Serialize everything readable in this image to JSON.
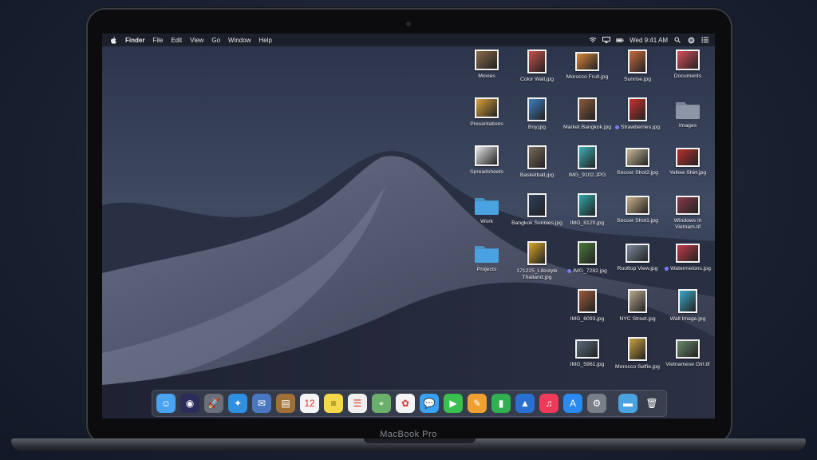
{
  "device": {
    "brand_label": "MacBook Pro"
  },
  "menubar": {
    "app_name": "Finder",
    "menus": [
      "File",
      "Edit",
      "View",
      "Go",
      "Window",
      "Help"
    ],
    "clock": "Wed 9:41 AM"
  },
  "desktop": {
    "items": [
      {
        "label": "Movies",
        "kind": "pile",
        "color": "#8a6a4a"
      },
      {
        "label": "Color Wall.jpg",
        "kind": "photo",
        "color": "#c8514a"
      },
      {
        "label": "Morocco Fruit.jpg",
        "kind": "photo-wide",
        "color": "#d7863a"
      },
      {
        "label": "Sunrise.jpg",
        "kind": "photo",
        "color": "#c96a3e"
      },
      {
        "label": "Documents",
        "kind": "pile",
        "color": "#d94f5c"
      },
      {
        "label": "Presentations",
        "kind": "pile",
        "color": "#d9a23a"
      },
      {
        "label": "Boy.jpg",
        "kind": "photo",
        "color": "#3f7fc0"
      },
      {
        "label": "Market Bangkok.jpg",
        "kind": "photo",
        "color": "#8b5a3a"
      },
      {
        "label": "Strawberries.jpg",
        "kind": "photo",
        "color": "#c9322e",
        "tag": true
      },
      {
        "label": "Images",
        "kind": "folder-gray",
        "color": "#8c96a6"
      },
      {
        "label": "Spreadsheets",
        "kind": "pile",
        "color": "#e6e6e6"
      },
      {
        "label": "Basketball.jpg",
        "kind": "photo",
        "color": "#7a6a5a"
      },
      {
        "label": "IMG_9102.JPG",
        "kind": "photo",
        "color": "#3fb0b8"
      },
      {
        "label": "Soccer Shot2.jpg",
        "kind": "photo-wide",
        "color": "#c8b89a"
      },
      {
        "label": "Yellow Shirt.jpg",
        "kind": "photo-wide",
        "color": "#b8302e"
      },
      {
        "label": "Work",
        "kind": "folder",
        "color": "#4aa3e0"
      },
      {
        "label": "Bangkok Sunnies.jpg",
        "kind": "photo",
        "color": "#2f3f5a"
      },
      {
        "label": "IMG_8120.jpg",
        "kind": "photo",
        "color": "#2fa8a8"
      },
      {
        "label": "Soccer Shot1.jpg",
        "kind": "photo-wide",
        "color": "#c9b08a"
      },
      {
        "label": "Windows in Vietnam.tif",
        "kind": "photo-wide",
        "color": "#8a3a4a"
      },
      {
        "label": "Projects",
        "kind": "folder",
        "color": "#4aa3e0"
      },
      {
        "label": "171225_Lifestyle Thailand.jpg",
        "kind": "photo",
        "color": "#d9a62a"
      },
      {
        "label": "IMG_7282.jpg",
        "kind": "photo",
        "color": "#4a7a3a",
        "tag": true
      },
      {
        "label": "Rooftop View.jpg",
        "kind": "photo-wide",
        "color": "#7a8a9a"
      },
      {
        "label": "Watermelons.jpg",
        "kind": "photo-wide",
        "color": "#c23a4a",
        "tag": true
      },
      {
        "label": "IMG_6093.jpg",
        "kind": "photo",
        "color": "#9a5a3a"
      },
      {
        "label": "NYC Street.jpg",
        "kind": "photo",
        "color": "#b8a890"
      },
      {
        "label": "Wall Image.jpg",
        "kind": "photo",
        "color": "#3aa8c8"
      },
      {
        "label": "IMG_5961.jpg",
        "kind": "photo-wide",
        "color": "#5a6a7a"
      },
      {
        "label": "Morocco Selfie.jpg",
        "kind": "photo",
        "color": "#c8a040"
      },
      {
        "label": "Vietnamese Girl.tif",
        "kind": "photo-wide",
        "color": "#6a8a6a"
      }
    ]
  },
  "dock": {
    "apps": [
      {
        "name": "finder-icon",
        "bg": "#4aa3f0",
        "glyph": "☺"
      },
      {
        "name": "siri-icon",
        "bg": "#2a2d5a",
        "glyph": "◉"
      },
      {
        "name": "launchpad-icon",
        "bg": "#6a6f7a",
        "glyph": "🚀"
      },
      {
        "name": "safari-icon",
        "bg": "#2f8fe0",
        "glyph": "✦"
      },
      {
        "name": "mail-icon",
        "bg": "#4a78c0",
        "glyph": "✉"
      },
      {
        "name": "contacts-icon",
        "bg": "#a0703a",
        "glyph": "▤"
      },
      {
        "name": "calendar-icon",
        "bg": "#f4f4f4",
        "glyph": "12"
      },
      {
        "name": "notes-icon",
        "bg": "#f5d84a",
        "glyph": "≡"
      },
      {
        "name": "reminders-icon",
        "bg": "#f0f0f0",
        "glyph": "☰"
      },
      {
        "name": "maps-icon",
        "bg": "#6ab06a",
        "glyph": "⌖"
      },
      {
        "name": "photos-icon",
        "bg": "#f4f4f4",
        "glyph": "✿"
      },
      {
        "name": "messages-icon",
        "bg": "#3aa0f0",
        "glyph": "💬"
      },
      {
        "name": "facetime-icon",
        "bg": "#3ac050",
        "glyph": "▶"
      },
      {
        "name": "pages-icon",
        "bg": "#f0a030",
        "glyph": "✎"
      },
      {
        "name": "numbers-icon",
        "bg": "#30b050",
        "glyph": "▮"
      },
      {
        "name": "keynote-icon",
        "bg": "#2a70d0",
        "glyph": "▲"
      },
      {
        "name": "music-icon",
        "bg": "#f03a5a",
        "glyph": "♫"
      },
      {
        "name": "app-store-icon",
        "bg": "#2a8af0",
        "glyph": "A"
      },
      {
        "name": "system-preferences-icon",
        "bg": "#7a7e86",
        "glyph": "⚙"
      }
    ],
    "right": [
      {
        "name": "downloads-folder-icon",
        "bg": "#4aa3e0",
        "glyph": "▬"
      },
      {
        "name": "trash-icon",
        "bg": "transparent",
        "glyph": "🗑"
      }
    ]
  }
}
